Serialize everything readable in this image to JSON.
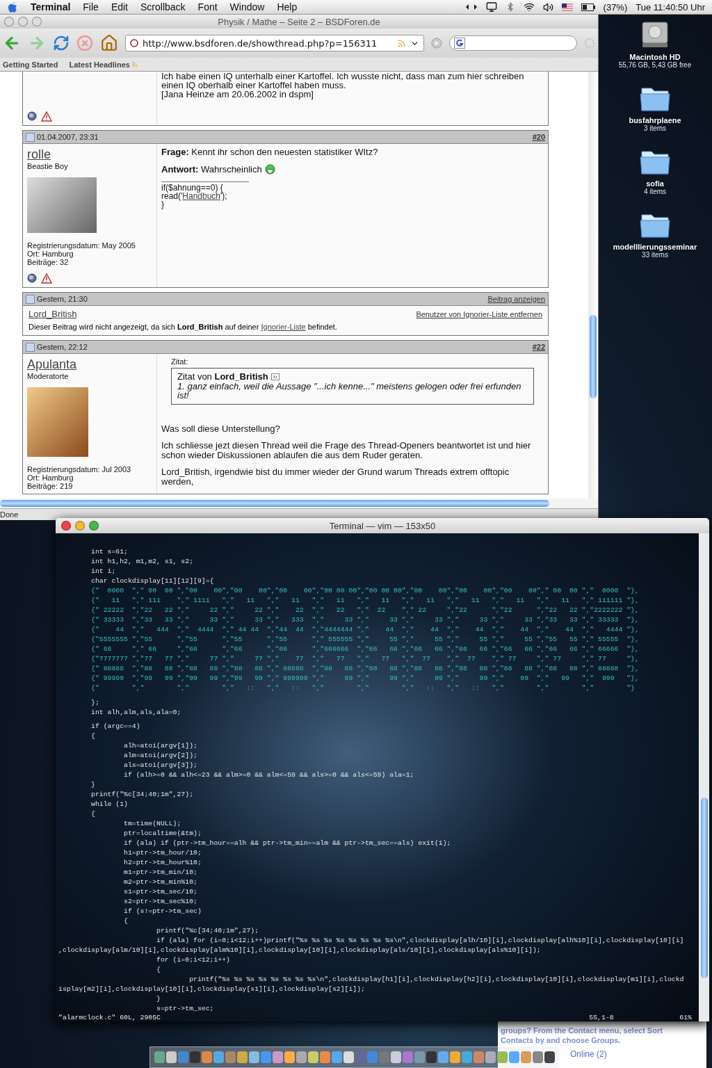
{
  "menubar": {
    "app": "Terminal",
    "menus": [
      "File",
      "Edit",
      "Scrollback",
      "Font",
      "Window",
      "Help"
    ],
    "battery": "(37%)",
    "clock": "Tue 11:40:50 Uhr"
  },
  "browser": {
    "title": "Physik / Mathe – Seite 2 – BSDForen.de",
    "url": "http://www.bsdforen.de/showthread.php?p=156311",
    "bookmarks": [
      "Getting Started",
      "Latest Headlines"
    ],
    "status": "Done",
    "signature_tail": [
      "Ich habe einen IQ unterhalb einer Kartoffel. Ich wusste nicht, dass man zum hier schreiben einen IQ oberhalb einer Kartoffel haben muss.",
      "[Jana Heinze am 20.06.2002 in dspm]"
    ],
    "posts": [
      {
        "kind": "full",
        "date": "01.04.2007, 23:31",
        "number": "#20",
        "user": "rolle",
        "rank": "Beastie Boy",
        "stats": [
          "Registrierungsdatum: May 2005",
          "Ort: Hamburg",
          "Beiträge: 32"
        ],
        "body": [
          {
            "kind": "text",
            "text": "**Frage:** Kennt ihr schon den neuesten statistiker WItz?",
            "smiley": false
          },
          {
            "kind": "text",
            "text": "**Antwort:** Wahrscheinlich",
            "smiley": true
          },
          {
            "kind": "signature",
            "lines": [
              {
                "before": "if($ahnung==0) {"
              },
              {
                "before": "read('",
                "link": "Handbuch",
                "after": "');"
              },
              {
                "before": "}"
              }
            ]
          }
        ]
      },
      {
        "kind": "ignored",
        "date": "Gestern, 21:30",
        "show_link": "Beitrag anzeigen",
        "user": "Lord_British",
        "remove_link": "Benutzer von Ignorier-Liste entfernen",
        "message": {
          "before": "Dieser Beitrag wird nicht angezeigt, da sich **Lord_British** auf deiner",
          "link": "Ignorier-Liste",
          "after": "befindet."
        }
      },
      {
        "kind": "full",
        "date": "Gestern, 22:12",
        "number": "#22",
        "user": "Apulanta",
        "rank": "Moderatorte",
        "stats": [
          "Registrierungsdatum: Jul 2003",
          "Ort: Hamburg",
          "Beiträge: 219"
        ],
        "body": [
          {
            "kind": "quote",
            "label": "Zitat:",
            "source": "Zitat von **Lord_British**",
            "text": "1. ganz einfach, weil die Aussage \"...ich kenne...\" meistens gelogen oder frei erfunden ist!"
          },
          {
            "kind": "text",
            "text": "Was soll diese Unterstellung?",
            "smiley": false
          },
          {
            "kind": "text",
            "text": "Ich schliesse jezt diesen Thread weil die Frage des Thread-Openers beantwortet ist und hier schon wieder Diskussionen ablaufen die aus dem Ruder geraten.",
            "smiley": false
          },
          {
            "kind": "text",
            "text": "Lord_British, irgendwie bist du immer wieder der Grund warum Threads extrem offtopic werden,",
            "smiley": false
          }
        ]
      }
    ]
  },
  "desktop": [
    {
      "kind": "disk",
      "name": "Macintosh HD",
      "info": "55,76 GB, 5,43 GB free"
    },
    {
      "kind": "folder",
      "name": "busfahrplaene",
      "info": "3 items"
    },
    {
      "kind": "folder",
      "name": "sofia",
      "info": "4 items"
    },
    {
      "kind": "folder",
      "name": "modelllierungsseminar",
      "info": "33 items"
    }
  ],
  "terminal": {
    "title": "Terminal — vim — 153x50",
    "lines": [
      {
        "kind": "code",
        "text": "        int s=61;"
      },
      {
        "kind": "code",
        "text": "        int h1,h2, m1,m2, s1, s2;"
      },
      {
        "kind": "code",
        "text": "        int i;"
      },
      {
        "kind": "code",
        "text": "        char clockdisplay[11][12][9]={"
      },
      {
        "kind": "digits",
        "text": "        {\"  0000  \",\" 00  00 \",\"00    00\",\"00    00\",\"00    00\",\"00 00 00\",\"00 00 00\",\"00    00\",\"00    00\",\"00    00\",\" 00  00 \",\"  0000  \"},"
      },
      {
        "kind": "digits",
        "text": "        {\"   11   \",\" 111    \",\" 1111   \",\"   11   \",\"   11   \",\"   11   \",\"   11   \",\"   11   \",\"   11   \",\"   11   \",\"   11   \",\" 111111 \"},"
      },
      {
        "kind": "digits",
        "text": "        {\" 22222  \",\"22   22 \",\"     22 \",\"     22 \",\"    22  \",\"   22   \",\"  22    \",\" 22     \",\"22      \",\"22      \",\"22   22 \",\"2222222 \"},"
      },
      {
        "kind": "digits",
        "text": "        {\" 33333  \",\"33   33 \",\"     33 \",\"     33 \",\"   333  \",\"     33 \",\"     33 \",\"     33 \",\"     33 \",\"     33 \",\"33   33 \",\" 33333  \"},"
      },
      {
        "kind": "digits",
        "text": "        {\"    44  \",\"   444  \",\"  4444  \",\" 44 44  \",\"44  44  \",\"4444444 \",\"    44  \",\"    44  \",\"    44  \",\"    44  \",\"    44  \",\"   4444 \"},"
      },
      {
        "kind": "digits",
        "text": "        {\"5555555 \",\"55      \",\"55      \",\"55      \",\"55      \",\" 555555 \",\"     55 \",\"     55 \",\"     55 \",\"     55 \",\"55   55 \",\" 55555  \"},"
      },
      {
        "kind": "digits",
        "text": "        {\" 66     \",\" 66     \",\"66      \",\"66      \",\"66      \",\"666666  \",\"66   66 \",\"66   66 \",\"66   66 \",\"66   66 \",\"66   66 \",\" 66666  \"},"
      },
      {
        "kind": "digits",
        "text": "        {\"7777777 \",\"77   77 \",\"     77 \",\"     77 \",\"    77  \",\"   77   \",\"   77   \",\"  77    \",\"  77    \",\" 77     \",\" 77     \",\" 77     \"},"
      },
      {
        "kind": "digits",
        "text": "        {\" 88888  \",\"88   88 \",\"88   88 \",\"88   88 \",\" 88888  \",\"88   88 \",\"88   88 \",\"88   88 \",\"88   88 \",\"88   88 \",\"88   88 \",\" 88888  \"},"
      },
      {
        "kind": "digits",
        "text": "        {\" 99999  \",\"99   99 \",\"99   99 \",\"99   99 \",\" 999999 \",\"     99 \",\"     99 \",\"     99 \",\"     99 \",\"    99  \",\"   99   \",\"  999   \"},"
      },
      {
        "kind": "digits",
        "text": "        {\"        \",\"        \",\"        \",\"   ::   \",\"   ::   \",\"        \",\"        \",\"   ::   \",\"   ::   \",\"        \",\"        \",\"        \"}"
      },
      {
        "kind": "blank"
      },
      {
        "kind": "code",
        "text": "        };"
      },
      {
        "kind": "code",
        "text": "        int alh,alm,als,ala=0;"
      },
      {
        "kind": "blank"
      },
      {
        "kind": "code",
        "text": "        if (argc==4)"
      },
      {
        "kind": "code",
        "text": "        {"
      },
      {
        "kind": "code",
        "text": "                alh=atoi(argv[1]);"
      },
      {
        "kind": "code",
        "text": "                alm=atoi(argv[2]);"
      },
      {
        "kind": "code",
        "text": "                als=atoi(argv[3]);"
      },
      {
        "kind": "code",
        "text": "                if (alh>=0 && alh<=23 && alm>=0 && alm<=59 && als>=0 && als<=59) ala=1;"
      },
      {
        "kind": "code",
        "text": "        }"
      },
      {
        "kind": "code",
        "text": "        printf(\"%c[34;40;1m\",27);"
      },
      {
        "kind": "code",
        "text": "        while (1)"
      },
      {
        "kind": "code",
        "text": "        {"
      },
      {
        "kind": "code",
        "text": "                tm=time(NULL);"
      },
      {
        "kind": "code",
        "text": "                ptr=localtime(&tm);"
      },
      {
        "kind": "code",
        "text": "                if (ala) if (ptr->tm_hour==alh && ptr->tm_min==alm && ptr->tm_sec==als) exit(1);"
      },
      {
        "kind": "code",
        "text": "                h1=ptr->tm_hour/10;"
      },
      {
        "kind": "code",
        "text": "                h2=ptr->tm_hour%10;"
      },
      {
        "kind": "code",
        "text": "                m1=ptr->tm_min/10;"
      },
      {
        "kind": "code",
        "text": "                m2=ptr->tm_min%10;"
      },
      {
        "kind": "code",
        "text": "                s1=ptr->tm_sec/10;"
      },
      {
        "kind": "code",
        "text": "                s2=ptr->tm_sec%10;"
      },
      {
        "kind": "code",
        "text": "                if (s!=ptr->tm_sec)"
      },
      {
        "kind": "code",
        "text": "                {"
      },
      {
        "kind": "code",
        "text": "                        printf(\"%c[34;40;1m\",27);"
      },
      {
        "kind": "code",
        "text": "                        if (ala) for (i=0;i<12;i++)printf(\"%s %s %s %s %s %s %s %s\\n\",clockdisplay[alh/10][i],clockdisplay[alh%10][i],clockdisplay[10][i]"
      },
      {
        "kind": "code",
        "text": ",clockdisplay[alm/10][i],clockdisplay[alm%10][i],clockdisplay[10][i],clockdisplay[als/10][i],clockdisplay[als%10][i]);"
      },
      {
        "kind": "code",
        "text": "                        for (i=0;i<12;i++)"
      },
      {
        "kind": "code",
        "text": "                        {"
      },
      {
        "kind": "code",
        "text": "                                printf(\"%s %s %s %s %s %s %s %s\\n\",clockdisplay[h1][i],clockdisplay[h2][i],clockdisplay[10][i],clockdisplay[m1][i],clockd"
      },
      {
        "kind": "code",
        "text": "isplay[m2][i],clockdisplay[10][i],clockdisplay[s1][i],clockdisplay[s2][i]);"
      },
      {
        "kind": "code",
        "text": "                        }"
      },
      {
        "kind": "code",
        "text": "                        s=ptr->tm_sec;"
      }
    ],
    "status": {
      "file": "\"alarmclock.c\" 60L, 2905C",
      "position": "55,1-8",
      "scroll": "61%"
    }
  },
  "contacts": {
    "tip": [
      "groups? From the Contact menu, select Sort",
      "Contacts by and choose Groups."
    ],
    "group": "Online (2)"
  }
}
